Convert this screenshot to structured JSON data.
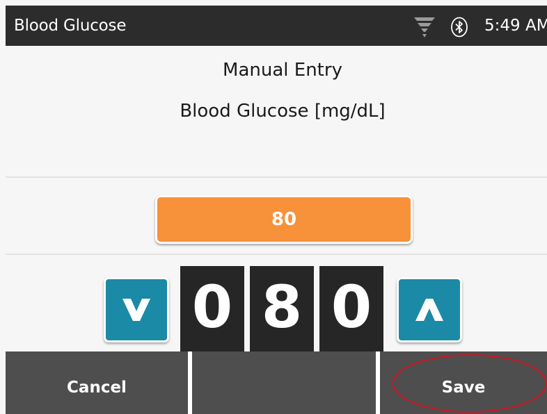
{
  "status_bar": {
    "title": "Blood Glucose",
    "time": "5:49 AM",
    "icons": [
      "signal-icon",
      "bluetooth-icon"
    ]
  },
  "main": {
    "heading": "Manual Entry",
    "measurement_label": "Blood Glucose [mg/dL]",
    "value": "80",
    "digits": [
      "0",
      "8",
      "0"
    ],
    "decrement_icon": "chevron-down-icon",
    "increment_icon": "chevron-up-icon"
  },
  "actions": {
    "cancel_label": "Cancel",
    "middle_label": "",
    "save_label": "Save"
  },
  "colors": {
    "title_bar": "#2c2c2c",
    "value_field": "#f7913a",
    "stepper": "#1b8aa7",
    "digit_bg": "#262626",
    "action_button": "#4e4e4e",
    "highlight_ring": "#d8101e"
  }
}
